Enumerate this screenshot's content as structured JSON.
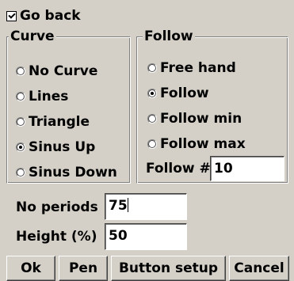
{
  "go_back": {
    "label": "Go back",
    "checked": true
  },
  "curve": {
    "title": "Curve",
    "options": [
      {
        "label": "No Curve",
        "selected": false
      },
      {
        "label": "Lines",
        "selected": false
      },
      {
        "label": "Triangle",
        "selected": false
      },
      {
        "label": "Sinus Up",
        "selected": true
      },
      {
        "label": "Sinus Down",
        "selected": false
      }
    ]
  },
  "follow": {
    "title": "Follow",
    "options": [
      {
        "label": "Free hand",
        "selected": false
      },
      {
        "label": "Follow",
        "selected": true
      },
      {
        "label": "Follow min",
        "selected": false
      },
      {
        "label": "Follow max",
        "selected": false
      }
    ],
    "number_label": "Follow #",
    "number_value": "10"
  },
  "periods": {
    "label": "No periods",
    "value": "75"
  },
  "height": {
    "label": "Height (%)",
    "value": "50"
  },
  "buttons": {
    "ok": "Ok",
    "pen": "Pen",
    "setup": "Button setup",
    "cancel": "Cancel"
  }
}
